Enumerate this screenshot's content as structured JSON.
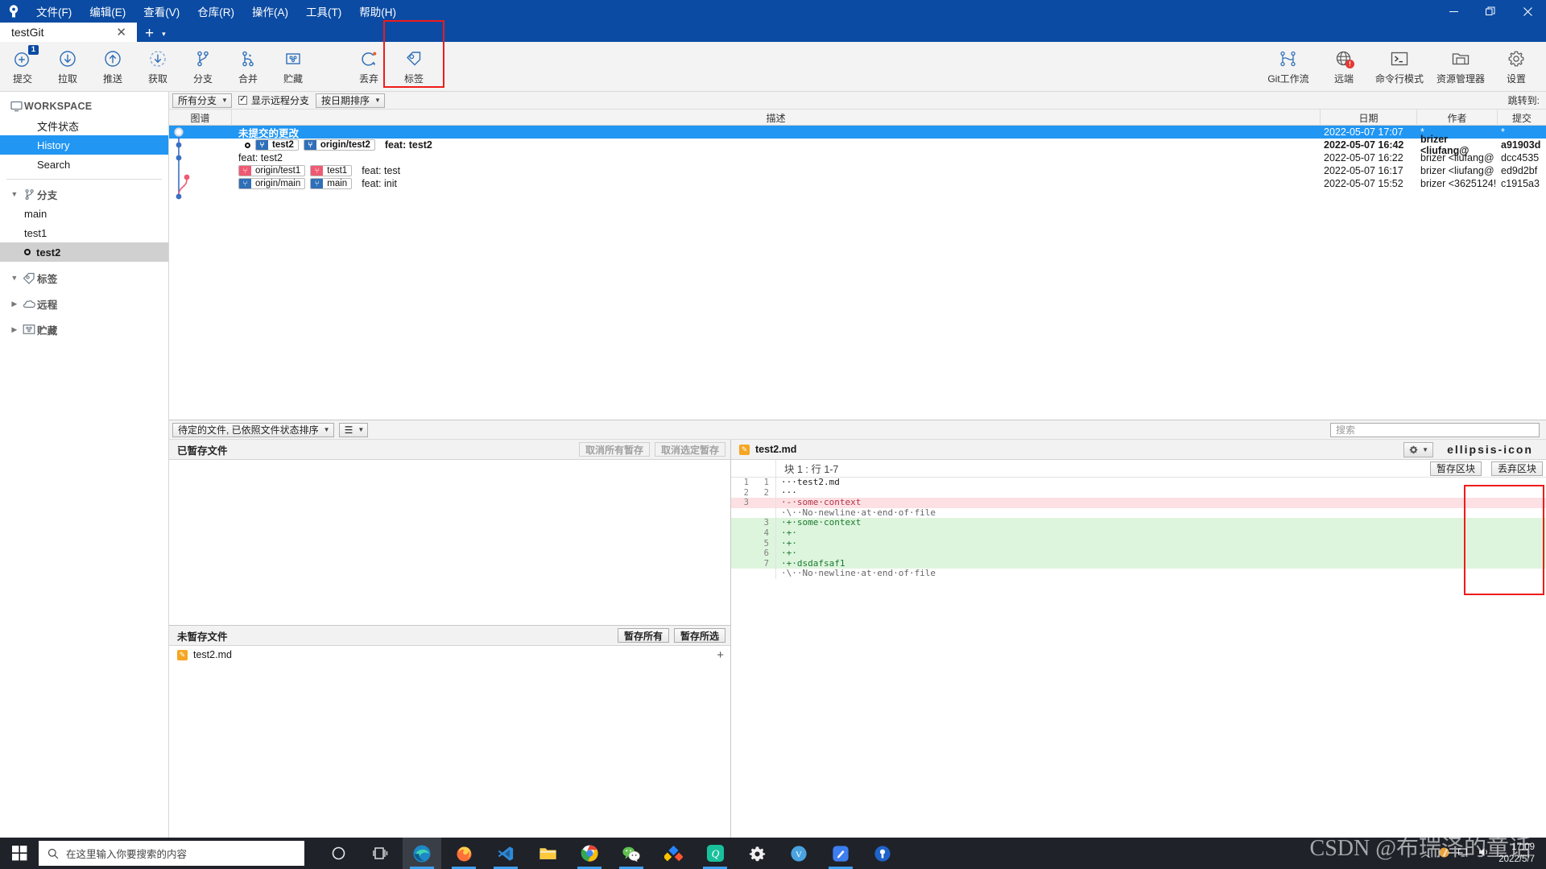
{
  "window": {
    "menu": [
      "文件(F)",
      "编辑(E)",
      "查看(V)",
      "仓库(R)",
      "操作(A)",
      "工具(T)",
      "帮助(H)"
    ],
    "minimize": "—",
    "maximize": "❐",
    "close": "✕"
  },
  "tabs": {
    "active": "testGit",
    "close": "✕",
    "add": "+",
    "more": "▾"
  },
  "toolbar": {
    "left": [
      {
        "label": "提交",
        "icon": "commit-plus-icon",
        "badge": "1"
      },
      {
        "label": "拉取",
        "icon": "pull-down-arrow-icon",
        "badge": ""
      },
      {
        "label": "推送",
        "icon": "push-up-arrow-icon",
        "badge": ""
      },
      {
        "label": "获取",
        "icon": "fetch-dashed-arrow-icon",
        "badge": ""
      },
      {
        "label": "分支",
        "icon": "branch-icon",
        "badge": ""
      },
      {
        "label": "合并",
        "icon": "merge-icon",
        "badge": ""
      },
      {
        "label": "贮藏",
        "icon": "stash-box-icon",
        "badge": ""
      },
      {
        "label": "丢弃",
        "icon": "discard-refresh-icon",
        "badge": ""
      },
      {
        "label": "标签",
        "icon": "tag-icon",
        "badge": ""
      }
    ],
    "right": [
      {
        "label": "Git工作流",
        "icon": "gitflow-icon",
        "alert": ""
      },
      {
        "label": "远端",
        "icon": "remote-globe-icon",
        "alert": "!"
      },
      {
        "label": "命令行模式",
        "icon": "terminal-icon",
        "alert": ""
      },
      {
        "label": "资源管理器",
        "icon": "explorer-folder-icon",
        "alert": ""
      },
      {
        "label": "设置",
        "icon": "gear-icon",
        "alert": ""
      }
    ]
  },
  "sidebar": {
    "workspace": {
      "label": "WORKSPACE",
      "icon": "monitor-icon"
    },
    "workspace_items": [
      {
        "label": "文件状态",
        "state": "normal"
      },
      {
        "label": "History",
        "state": "selected"
      },
      {
        "label": "Search",
        "state": "normal"
      }
    ],
    "sections": [
      {
        "label": "分支",
        "icon": "branch-icon",
        "expanded": true,
        "items": [
          {
            "label": "main",
            "current": false
          },
          {
            "label": "test1",
            "current": false
          },
          {
            "label": "test2",
            "current": true
          }
        ]
      },
      {
        "label": "标签",
        "icon": "tag-icon",
        "expanded": true,
        "items": []
      },
      {
        "label": "远程",
        "icon": "cloud-icon",
        "expanded": false,
        "items": []
      },
      {
        "label": "贮藏",
        "icon": "stash-box-icon",
        "expanded": false,
        "items": []
      }
    ]
  },
  "log": {
    "filters": {
      "branch_scope": "所有分支",
      "show_remote_label": "显示远程分支",
      "show_remote_checked": true,
      "sort": "按日期排序",
      "jump_to": "跳转到:"
    },
    "columns": [
      "图谱",
      "描述",
      "日期",
      "作者",
      "提交"
    ],
    "rows": [
      {
        "selected": true,
        "bold": false,
        "uncommitted": true,
        "desc": "未提交的更改",
        "refs": [],
        "date": "2022-05-07 17:07",
        "author": "*",
        "commit": "*"
      },
      {
        "selected": false,
        "bold": true,
        "head": true,
        "desc": "feat: test2",
        "refs": [
          {
            "name": "test2",
            "color": "blue"
          },
          {
            "name": "origin/test2",
            "color": "blue"
          }
        ],
        "date": "2022-05-07 16:42",
        "author": "brizer <liufang@",
        "commit": "a91903d"
      },
      {
        "selected": false,
        "bold": false,
        "desc": "feat: test2",
        "refs": [],
        "date": "2022-05-07 16:22",
        "author": "brizer <liufang@",
        "commit": "dcc4535"
      },
      {
        "selected": false,
        "bold": false,
        "desc": "feat: test",
        "refs": [
          {
            "name": "origin/test1",
            "color": "pink"
          },
          {
            "name": "test1",
            "color": "pink"
          }
        ],
        "date": "2022-05-07 16:17",
        "author": "brizer <liufang@",
        "commit": "ed9d2bf"
      },
      {
        "selected": false,
        "bold": false,
        "desc": "feat: init",
        "refs": [
          {
            "name": "origin/main",
            "color": "blue"
          },
          {
            "name": "main",
            "color": "blue"
          }
        ],
        "date": "2022-05-07 15:52",
        "author": "brizer <3625124!",
        "commit": "c1915a3"
      }
    ]
  },
  "lower": {
    "sort_combo": "待定的文件, 已依照文件状态排序",
    "view_combo_icon": "list-view-icon",
    "search_placeholder": "搜索"
  },
  "staged": {
    "title": "已暂存文件",
    "unstage_all": "取消所有暂存",
    "unstage_selected": "取消选定暂存",
    "files": []
  },
  "unstaged": {
    "title": "未暂存文件",
    "stage_all": "暂存所有",
    "stage_selected": "暂存所选",
    "files": [
      {
        "name": "test2.md",
        "status": "modified",
        "add": "+"
      }
    ]
  },
  "diff": {
    "filename": "test2.md",
    "gear_icon": "gear-icon",
    "more_icon": "ellipsis-icon",
    "hunk_label": "块 1 :  行 1-7",
    "stage_hunk": "暂存区块",
    "discard_hunk": "丢弃区块",
    "lines": [
      {
        "old": "1",
        "new": "1",
        "kind": "ctx",
        "text": "···test2.md"
      },
      {
        "old": "2",
        "new": "2",
        "kind": "ctx",
        "text": "···"
      },
      {
        "old": "3",
        "new": "",
        "kind": "del",
        "text": "·-·some·context"
      },
      {
        "old": "",
        "new": "",
        "kind": "meta",
        "text": "·\\··No·newline·at·end·of·file"
      },
      {
        "old": "",
        "new": "3",
        "kind": "add",
        "text": "·+·some·context"
      },
      {
        "old": "",
        "new": "4",
        "kind": "add",
        "text": "·+·"
      },
      {
        "old": "",
        "new": "5",
        "kind": "add",
        "text": "·+·"
      },
      {
        "old": "",
        "new": "6",
        "kind": "add",
        "text": "·+·"
      },
      {
        "old": "",
        "new": "7",
        "kind": "add",
        "text": "·+·dsdafsaf1"
      },
      {
        "old": "",
        "new": "",
        "kind": "meta",
        "text": "·\\··No·newline·at·end·of·file"
      }
    ]
  },
  "taskbar": {
    "search_placeholder": "在这里输入你要搜索的内容",
    "start_icon": "windows-start-icon",
    "icons": [
      {
        "name": "cortana-icon"
      },
      {
        "name": "task-view-icon"
      },
      {
        "name": "edge-icon"
      },
      {
        "name": "firefox-icon"
      },
      {
        "name": "vscode-icon"
      },
      {
        "name": "file-explorer-icon"
      },
      {
        "name": "chrome-icon"
      },
      {
        "name": "wechat-icon"
      },
      {
        "name": "sourcetree-icon"
      },
      {
        "name": "qq-icon"
      },
      {
        "name": "settings-icon"
      },
      {
        "name": "v2ray-icon"
      },
      {
        "name": "notes-icon"
      },
      {
        "name": "location-icon"
      }
    ],
    "clock_time": "17:09",
    "clock_date": "2022/5/7"
  },
  "watermark": {
    "text": "CSDN @布瑞泽的童话"
  },
  "colors": {
    "titlebar": "#0b4ba3",
    "selection": "#2196f3",
    "accent": "#2f6fb8",
    "pink": "#ef5a72",
    "add": "#ddf5dd",
    "del": "#fde0e3",
    "annotation": "#ef1b1b"
  }
}
